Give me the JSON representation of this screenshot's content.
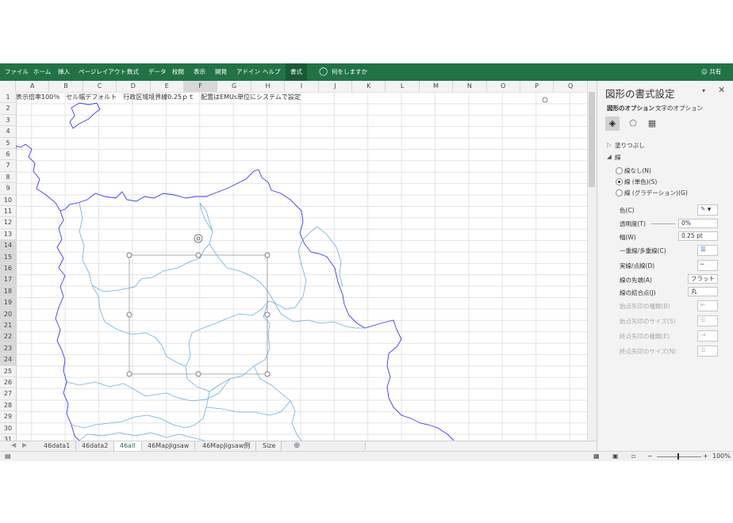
{
  "ribbon": {
    "tabs": [
      "ファイル",
      "ホーム",
      "挿入",
      "ページレイアウト",
      "数式",
      "データ",
      "校閲",
      "表示",
      "開発",
      "アドイン",
      "ヘルプ",
      "書式"
    ],
    "active_tab": "書式",
    "tell_me": "何をしますか",
    "share": "共有"
  },
  "sheet": {
    "columns": [
      "A",
      "B",
      "C",
      "D",
      "E",
      "F",
      "G",
      "H",
      "I",
      "J",
      "K",
      "L",
      "M",
      "N",
      "O",
      "P",
      "Q"
    ],
    "rows": [
      "1",
      "2",
      "3",
      "4",
      "5",
      "6",
      "7",
      "8",
      "9",
      "10",
      "11",
      "12",
      "13",
      "14",
      "15",
      "16",
      "17",
      "18",
      "19",
      "20",
      "21",
      "22",
      "23",
      "24",
      "25",
      "26",
      "27",
      "28",
      "29",
      "30",
      "31"
    ],
    "cell_a1": "表示倍率100％　セル幅デフォルト　行政区域境界線0.25ｐｔ　配置はEMUs単位にシステムで設定"
  },
  "sheet_tabs": [
    "46data1",
    "46data2",
    "46all",
    "46MapJigsaw",
    "46MapJigsaw例",
    "Size"
  ],
  "active_sheet": "46all",
  "status": {
    "zoom": "100%"
  },
  "pane": {
    "title": "図形の書式設定",
    "tab_shape": "図形のオプション",
    "tab_text": "文字のオプション",
    "fill_section": "塗りつぶし",
    "line_section": "線",
    "radio_none": "線なし(N)",
    "radio_solid": "線 (単色)(S)",
    "radio_gradient": "線 (グラデーション)(G)",
    "color_label": "色(C)",
    "transparency_label": "透明度(T)",
    "transparency_value": "0%",
    "width_label": "幅(W)",
    "width_value": "0.25 pt",
    "compound_label": "一重線/多重線(C)",
    "dash_label": "実線/点線(D)",
    "cap_label": "線の先端(A)",
    "cap_value": "フラット",
    "join_label": "線の結合点(J)",
    "join_value": "丸",
    "begin_arrow_type": "始点矢印の種類(B)",
    "begin_arrow_size": "始点矢印のサイズ(S)",
    "end_arrow_type": "終点矢印の種類(E)",
    "end_arrow_size": "終点矢印のサイズ(N)"
  },
  "colors": {
    "excel_green": "#217346",
    "outer_border": "#3a3aff",
    "inner_border": "#6ab0de"
  }
}
